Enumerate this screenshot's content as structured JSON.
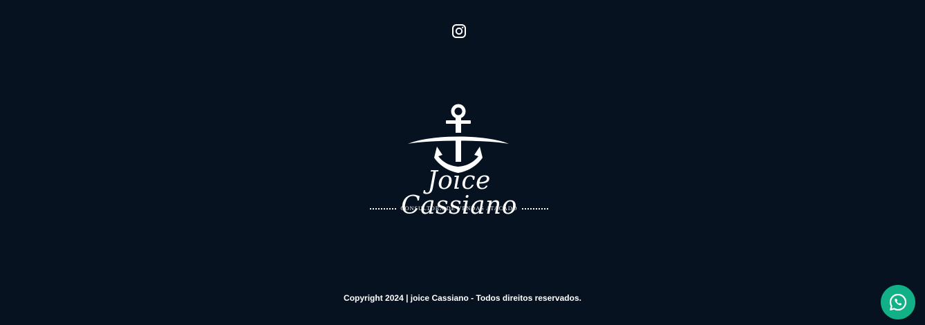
{
  "social": {
    "instagram_icon": "instagram-icon"
  },
  "logo": {
    "icon": "anchor-icon",
    "name": "Joice Cassiano",
    "tagline": "CONSULTORA DE VENDAS ATACADO"
  },
  "footer": {
    "copyright": "Copyright 2024 | joice Cassiano - Todos direitos reservados."
  },
  "chat": {
    "icon": "whatsapp-icon",
    "color": "#12b087"
  },
  "colors": {
    "background": "#061220",
    "foreground": "#ffffff"
  }
}
